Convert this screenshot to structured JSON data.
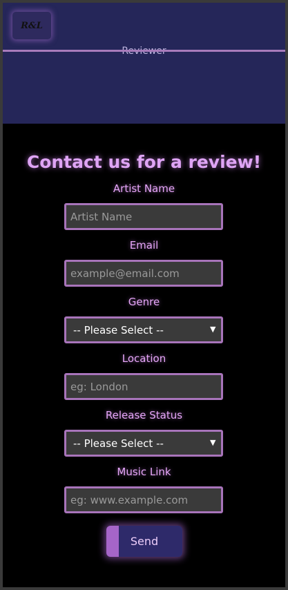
{
  "header": {
    "hidden_text": "Reviewer",
    "logo_text": "R&L"
  },
  "form": {
    "title": "Contact us for a review!",
    "fields": [
      {
        "label": "Artist Name",
        "placeholder": "Artist Name"
      },
      {
        "label": "Email",
        "placeholder": "example@email.com"
      },
      {
        "label": "Genre",
        "selected": "-- Please Select --"
      },
      {
        "label": "Location",
        "placeholder": "eg: London"
      },
      {
        "label": "Release Status",
        "selected": "-- Please Select --"
      },
      {
        "label": "Music Link",
        "placeholder": "eg: www.example.com"
      }
    ],
    "submit_label": "Send"
  },
  "colors": {
    "header_bg": "#252659",
    "accent": "#a874ba",
    "label": "#e6a6f8"
  }
}
